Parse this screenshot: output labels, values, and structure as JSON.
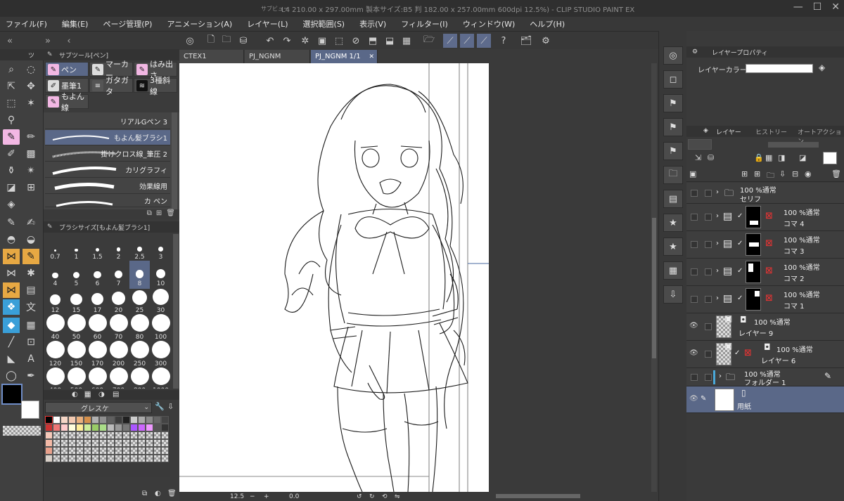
{
  "window": {
    "title": "L4 210.00 x 297.00mm 製本サイズ:B5 判 182.00 x 257.00mm 600dpi 12.5%) - CLIP STUDIO PAINT EX",
    "left_label": "サブビュー"
  },
  "menu": [
    "ファイル(F)",
    "編集(E)",
    "ページ管理(P)",
    "アニメーション(A)",
    "レイヤー(L)",
    "選択範囲(S)",
    "表示(V)",
    "フィルター(I)",
    "ウィンドウ(W)",
    "ヘルプ(H)"
  ],
  "tool_panel": {
    "title": "ツ"
  },
  "subtool": {
    "header": "サブツール[ペン]",
    "groups": [
      "ペン",
      "マーカー",
      "はみ出さ",
      "墨筆1",
      "ガタガタ",
      "3種斜線",
      "もよん線"
    ],
    "brushes": [
      "リアルGペン 3",
      "もよん髪ブラシ1",
      "掛けクロス線_筆圧 2",
      "カリグラフィ",
      "効果線用",
      "カ ペン"
    ]
  },
  "brush_size": {
    "header": "ブラシサイズ[もよん髪ブラシ1]",
    "sizes": [
      "0.7",
      "1",
      "1.5",
      "2",
      "2.5",
      "3",
      "4",
      "5",
      "6",
      "7",
      "8",
      "10",
      "12",
      "15",
      "17",
      "20",
      "25",
      "30",
      "40",
      "50",
      "60",
      "70",
      "80",
      "100",
      "120",
      "150",
      "170",
      "200",
      "250",
      "300",
      "400",
      "500",
      "600",
      "700",
      "800",
      "1000"
    ],
    "selected": "8"
  },
  "color_set": {
    "name": "グレスケ"
  },
  "tabs": [
    "CTEX1",
    "PJ_NGNM",
    "PJ_NGNM 1/1"
  ],
  "status": {
    "zoom": "12.5",
    "angle": "0.0"
  },
  "layer_property": {
    "tab": "レイヤープロパティ",
    "color_label": "レイヤーカラー"
  },
  "layer_panel": {
    "tabs": [
      "レイヤー",
      "ヒストリー",
      "オートアクション"
    ],
    "layers": [
      {
        "blend": "100 %通常",
        "name": "セリフ"
      },
      {
        "blend": "100 %通常",
        "name": "コマ 4"
      },
      {
        "blend": "100 %通常",
        "name": "コマ 3"
      },
      {
        "blend": "100 %通常",
        "name": "コマ 2"
      },
      {
        "blend": "100 %通常",
        "name": "コマ 1"
      },
      {
        "blend": "100 %通常",
        "name": "レイヤー 9"
      },
      {
        "blend": "100 %通常",
        "name": "レイヤー 6"
      },
      {
        "blend": "100 %通常",
        "name": "フォルダー 1"
      },
      {
        "blend": "",
        "name": "用紙"
      }
    ]
  }
}
